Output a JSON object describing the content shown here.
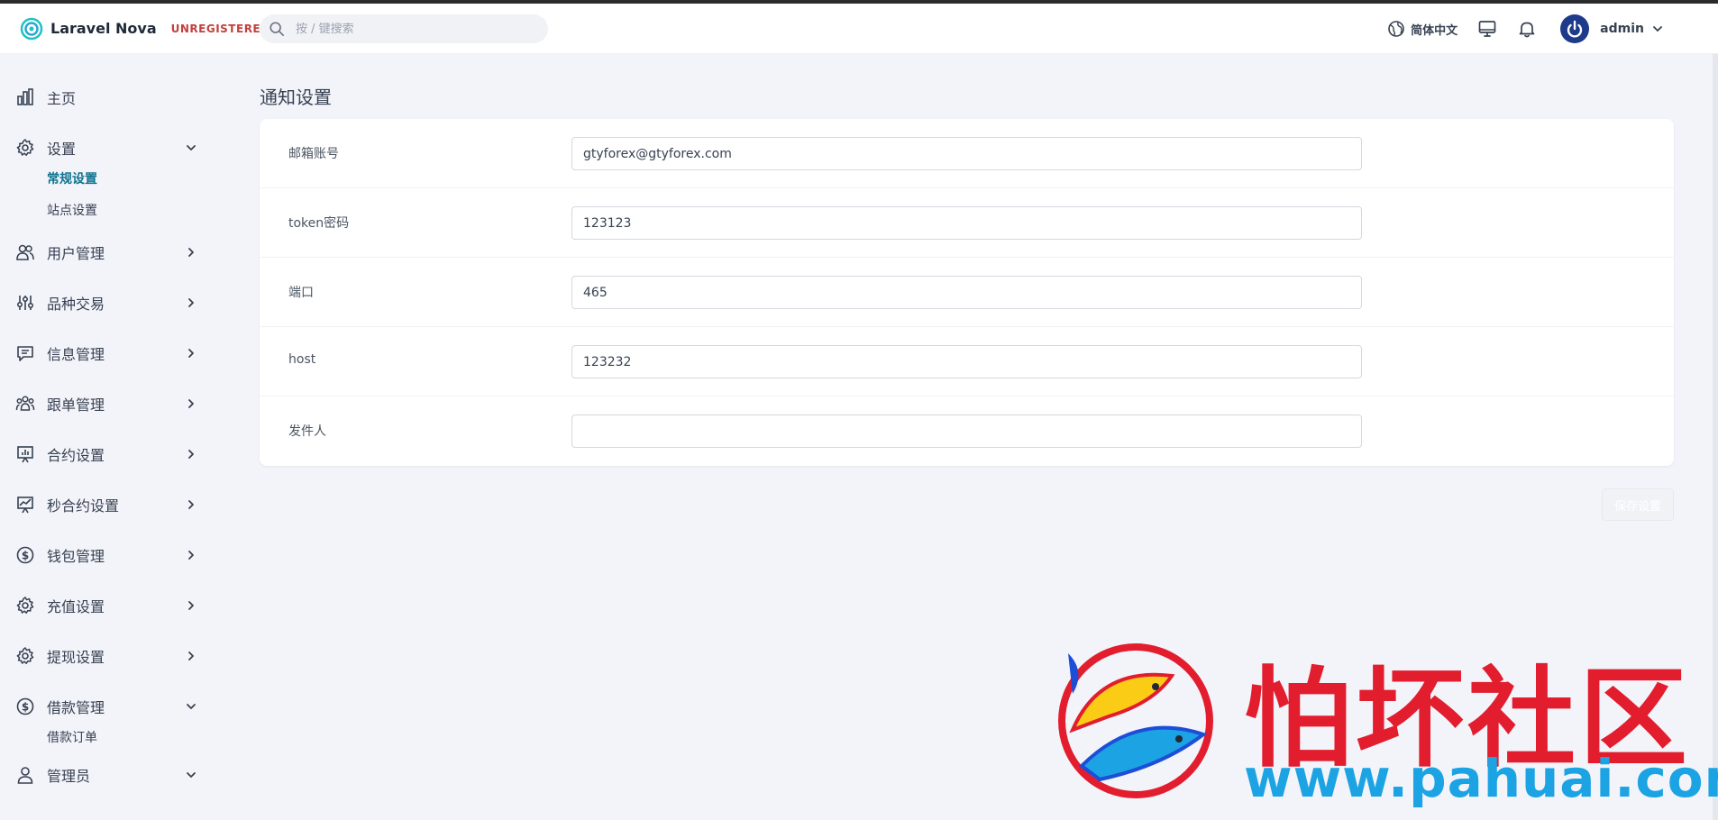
{
  "header": {
    "app_name": "Laravel Nova",
    "license_status": "UNREGISTERED",
    "search_placeholder": "按 / 键搜索",
    "language": "简体中文",
    "user_name": "admin"
  },
  "sidebar": {
    "home": "主页",
    "settings": "设置",
    "settings_sub": [
      "常规设置",
      "站点设置"
    ],
    "users": "用户管理",
    "products": "品种交易",
    "messages": "信息管理",
    "copy_trading": "跟单管理",
    "contract_settings": "合约设置",
    "second_contract": "秒合约设置",
    "wallet": "钱包管理",
    "recharge": "充值设置",
    "withdraw": "提现设置",
    "loans": "借款管理",
    "loans_sub": [
      "借款订单"
    ],
    "admins": "管理员"
  },
  "main": {
    "title": "通知设置",
    "fields": [
      {
        "label": "邮箱账号",
        "value": "gtyforex@gtyforex.com"
      },
      {
        "label": "token密码",
        "value": "123123"
      },
      {
        "label": "端口",
        "value": "465"
      },
      {
        "label": "host",
        "value": "123232"
      },
      {
        "label": "发件人",
        "value": ""
      }
    ],
    "save_label": "保存设置"
  },
  "watermark": {
    "title": "怕坏社区",
    "url": "www.pahuai.com"
  },
  "colors": {
    "accent": "#0e7490",
    "unregistered": "#c2413e",
    "avatar": "#1e3a8a",
    "watermark_red": "#e11d2e",
    "watermark_blue": "#1ba3e3"
  },
  "icons": {
    "logo": "nova-logo-icon",
    "search": "search-icon",
    "language": "globe-icon",
    "monitor": "monitor-icon",
    "notifications": "bell-icon",
    "avatar": "power-icon"
  }
}
